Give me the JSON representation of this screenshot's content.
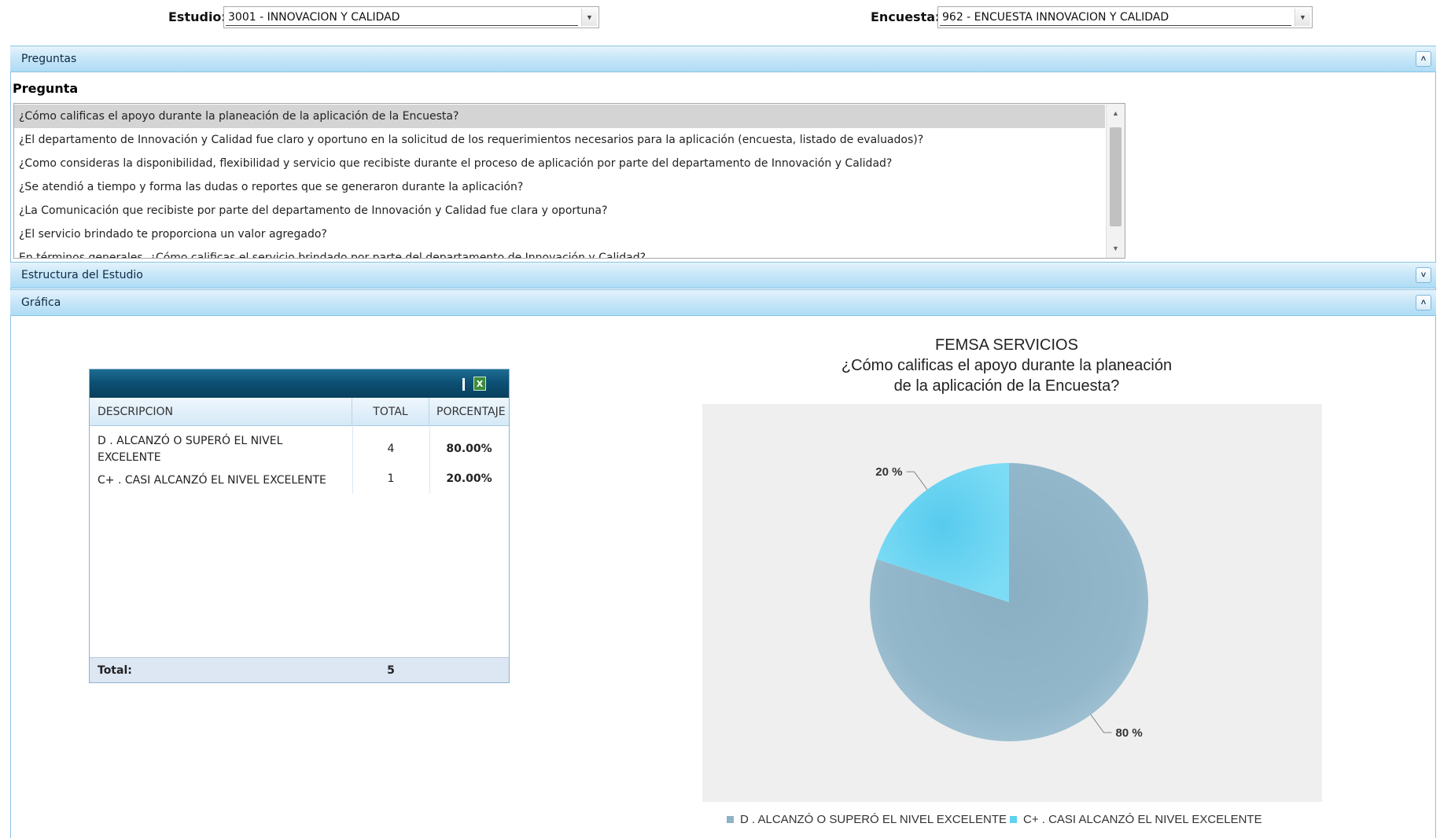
{
  "filters": {
    "estudio_label": "Estudio:",
    "estudio_value": "3001 - INNOVACION Y CALIDAD",
    "encuesta_label": "Encuesta:",
    "encuesta_value": "962 - ENCUESTA INNOVACION Y CALIDAD"
  },
  "panels": {
    "preguntas": {
      "title": "Preguntas",
      "toggle": "˄"
    },
    "estructura": {
      "title": "Estructura del Estudio",
      "toggle": "˅"
    },
    "grafica": {
      "title": "Gráfica",
      "toggle": "˄"
    }
  },
  "pregunta_label": "Pregunta",
  "questions": [
    "¿Cómo calificas el apoyo durante la planeación de la aplicación de la Encuesta?",
    "¿El departamento de Innovación y Calidad fue claro y oportuno en la solicitud de los requerimientos necesarios para la aplicación (encuesta, listado de evaluados)?",
    "¿Como consideras la disponibilidad, flexibilidad y servicio que recibiste durante el proceso de aplicación por parte del departamento de Innovación y Calidad?",
    "¿Se atendió a tiempo y forma las dudas o reportes que se generaron durante la aplicación?",
    "¿La Comunicación que recibiste por parte del departamento de Innovación y Calidad fue clara y oportuna?",
    "¿El servicio brindado te proporciona un valor agregado?",
    "En términos generales, ¿Cómo calificas el servicio brindado por parte del departamento de Innovación y Calidad?"
  ],
  "selected_question": 0,
  "grid": {
    "headers": {
      "descripcion": "DESCRIPCION",
      "total": "TOTAL",
      "porcentaje": "PORCENTAJE"
    },
    "rows": [
      {
        "descripcion": "D . ALCANZÓ O SUPERÓ EL NIVEL EXCELENTE",
        "total": "4",
        "porcentaje": "80.00%"
      },
      {
        "descripcion": "C+ . CASI ALCANZÓ EL NIVEL EXCELENTE",
        "total": "1",
        "porcentaje": "20.00%"
      }
    ],
    "footer": {
      "label": "Total:",
      "total": "5"
    },
    "excel_icon": "excel-export-icon"
  },
  "chart_data": {
    "type": "pie",
    "title": "FEMSA SERVICIOS",
    "subtitle_lines": [
      "¿Cómo calificas el apoyo durante la planeación",
      "de la aplicación de la Encuesta?"
    ],
    "categories": [
      "D . ALCANZÓ O SUPERÓ EL NIVEL EXCELENTE",
      "C+ . CASI ALCANZÓ EL NIVEL EXCELENTE"
    ],
    "values": [
      80,
      20
    ],
    "labels": [
      "80 %",
      "20 %"
    ],
    "colors": [
      "#8fb3c6",
      "#5fd1f2"
    ],
    "legend_position": "bottom"
  }
}
